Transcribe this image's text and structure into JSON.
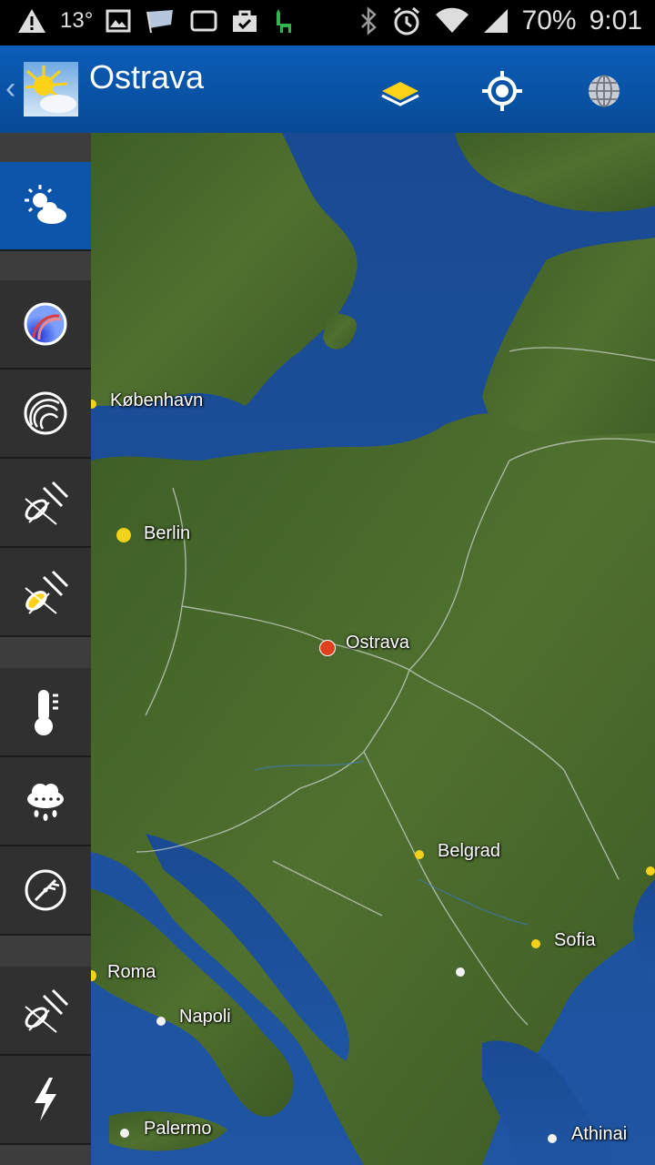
{
  "status_bar": {
    "temperature": "13°",
    "battery": "70%",
    "time": "9:01"
  },
  "app_bar": {
    "title": "Ostrava",
    "back_glyph": "‹"
  },
  "sidebar": {
    "items": [
      {
        "icon": "weather-sun-cloud-icon",
        "active": true
      },
      {
        "icon": "radar-color-icon"
      },
      {
        "icon": "radar-icon"
      },
      {
        "icon": "satellite-icon"
      },
      {
        "icon": "satellite-color-icon"
      },
      {
        "icon": "thermometer-icon"
      },
      {
        "icon": "rain-cloud-icon"
      },
      {
        "icon": "wind-gauge-icon"
      },
      {
        "icon": "satellite-alt-icon"
      },
      {
        "icon": "lightning-icon"
      }
    ]
  },
  "map": {
    "cities": [
      {
        "name": "København",
        "type": "yellow"
      },
      {
        "name": "Berlin",
        "type": "yellow"
      },
      {
        "name": "Ostrava",
        "type": "selected"
      },
      {
        "name": "Belgrad",
        "type": "yellow"
      },
      {
        "name": "Sofia",
        "type": "yellow"
      },
      {
        "name": "Roma",
        "type": "yellow"
      },
      {
        "name": "Napoli",
        "type": "white"
      },
      {
        "name": "Palermo",
        "type": "white"
      },
      {
        "name": "Athinai",
        "type": "white"
      }
    ]
  },
  "colors": {
    "app_bar": "#0a5db8",
    "sidebar_active": "#0c55aa",
    "sea": "#1f4f9a",
    "land": "#4a6a2c",
    "selected_city": "#e0401c",
    "city": "#f2d21a"
  }
}
